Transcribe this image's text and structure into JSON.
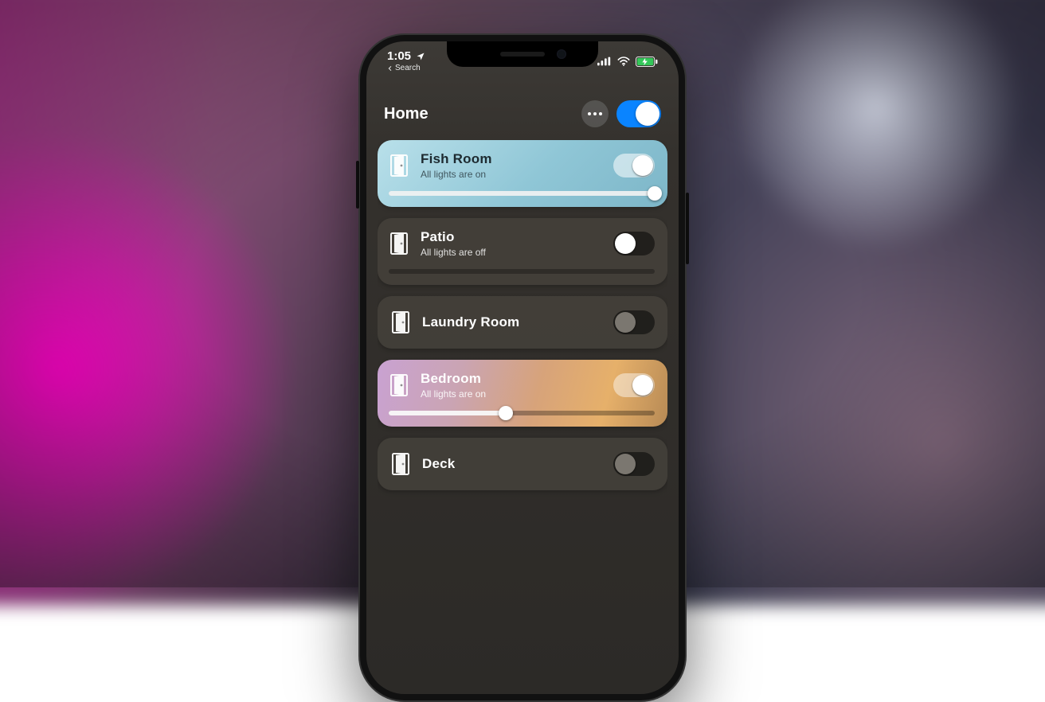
{
  "status_bar": {
    "time": "1:05",
    "back_label": "Search",
    "location_icon": "location-arrow-icon",
    "signal_icon": "cellular-signal-icon",
    "wifi_icon": "wifi-icon",
    "battery_icon": "battery-charging-icon"
  },
  "header": {
    "title": "Home",
    "more_icon": "more-horizontal-icon",
    "master_toggle": {
      "on": true,
      "on_color": "#0a84ff",
      "off_color": "#6b6b6b"
    }
  },
  "rooms": [
    {
      "id": "fish-room",
      "name": "Fish Room",
      "status": "All lights are on",
      "toggle_on": true,
      "has_slider": true,
      "brightness_pct": 100,
      "card_kind": "fish",
      "toggle_track_color": "rgba(255,255,255,0.55)",
      "toggle_knob_color": "#ffffff",
      "text_color": "#1d2a30"
    },
    {
      "id": "patio",
      "name": "Patio",
      "status": "All lights are off",
      "toggle_on": false,
      "has_slider": true,
      "brightness_pct": 0,
      "card_kind": "dark",
      "toggle_track_color": "rgba(0,0,0,0.5)",
      "toggle_knob_color": "#ffffff",
      "text_color": "#ffffff"
    },
    {
      "id": "laundry-room",
      "name": "Laundry Room",
      "status": "",
      "toggle_on": false,
      "has_slider": false,
      "brightness_pct": 0,
      "card_kind": "dark compact",
      "toggle_track_color": "rgba(0,0,0,0.5)",
      "toggle_knob_color": "#7b7770",
      "text_color": "#ffffff"
    },
    {
      "id": "bedroom",
      "name": "Bedroom",
      "status": "All lights are on",
      "toggle_on": true,
      "has_slider": true,
      "brightness_pct": 44,
      "card_kind": "bedroom",
      "toggle_track_color": "rgba(255,255,255,0.45)",
      "toggle_knob_color": "#ffffff",
      "text_color": "#ffffff"
    },
    {
      "id": "deck",
      "name": "Deck",
      "status": "",
      "toggle_on": false,
      "has_slider": false,
      "brightness_pct": 0,
      "card_kind": "dark compact",
      "toggle_track_color": "rgba(0,0,0,0.5)",
      "toggle_knob_color": "#7b7770",
      "text_color": "#ffffff"
    }
  ],
  "colors": {
    "toggle_on": "#0a84ff"
  }
}
